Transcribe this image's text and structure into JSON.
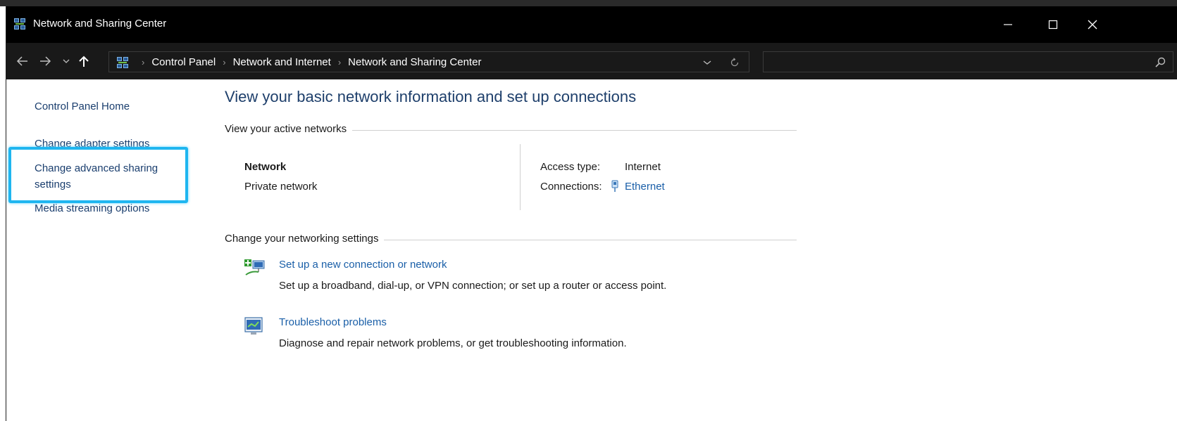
{
  "window": {
    "title": "Network and Sharing Center"
  },
  "address_bar": {
    "breadcrumbs": [
      "Control Panel",
      "Network and Internet",
      "Network and Sharing Center"
    ],
    "search_placeholder": ""
  },
  "sidebar": {
    "items": [
      {
        "label": "Control Panel Home"
      },
      {
        "label": "Change adapter settings"
      },
      {
        "label_line1": "Change advanced sharing",
        "label_line2": "settings",
        "highlighted": true
      },
      {
        "label": "Media streaming options"
      }
    ],
    "highlight_color": "#1fb6f0"
  },
  "main": {
    "heading": "View your basic network information and set up connections",
    "active_networks_label": "View your active networks",
    "network": {
      "name": "Network",
      "profile": "Private network",
      "access_type_label": "Access type:",
      "access_type_value": "Internet",
      "connections_label": "Connections:",
      "connections_value": "Ethernet"
    },
    "change_settings_label": "Change your networking settings",
    "tasks": [
      {
        "icon": "new-connection-icon",
        "link": "Set up a new connection or network",
        "description": "Set up a broadband, dial-up, or VPN connection; or set up a router or access point."
      },
      {
        "icon": "troubleshoot-icon",
        "link": "Troubleshoot problems",
        "description": "Diagnose and repair network problems, or get troubleshooting information."
      }
    ]
  },
  "colors": {
    "titlebar_bg": "#000000",
    "addressbar_bg": "#191919",
    "link": "#1a5fa8",
    "heading": "#1e3f6b"
  }
}
